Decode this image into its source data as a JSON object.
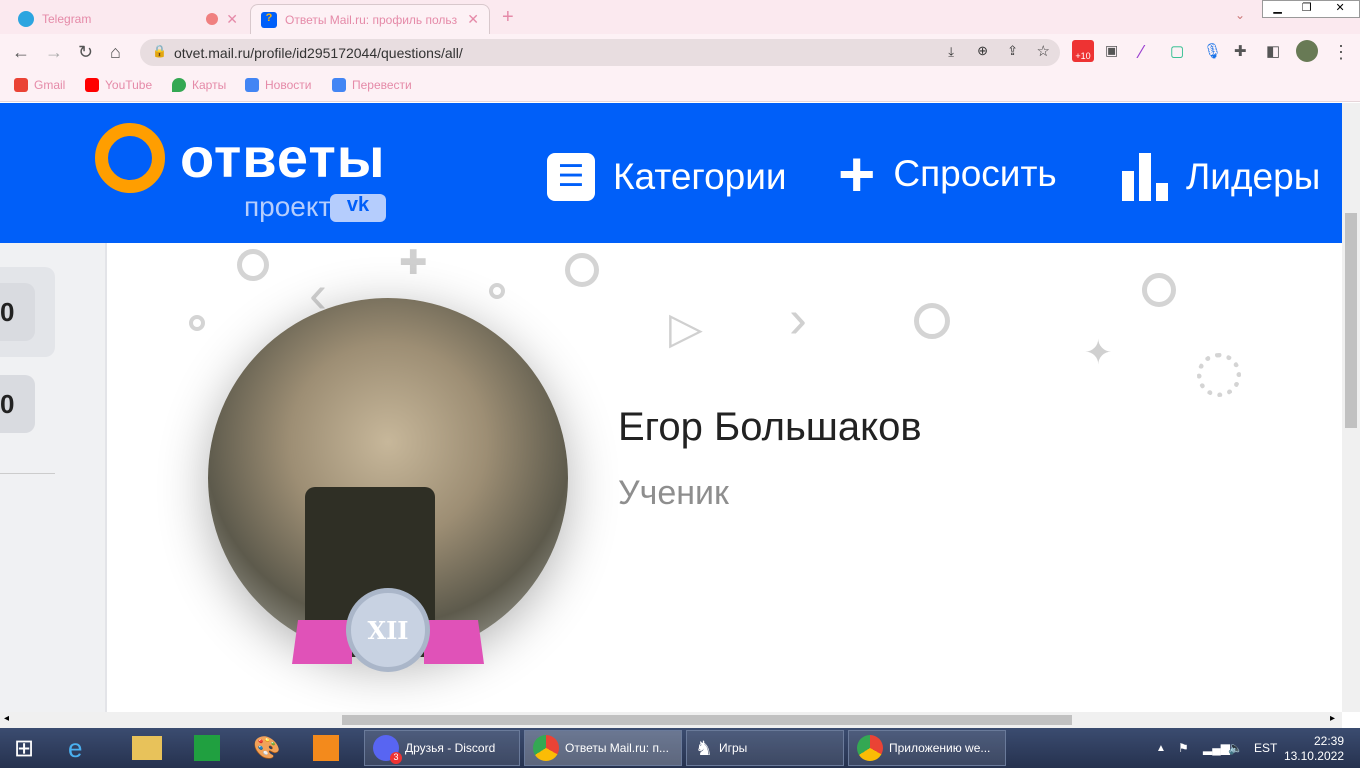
{
  "browser": {
    "tabs": [
      {
        "label": "Telegram",
        "active": false
      },
      {
        "label": "Ответы Mail.ru: профиль польз",
        "active": true
      }
    ],
    "url": "otvet.mail.ru/profile/id295172044/questions/all/",
    "extension_badge": "+10",
    "bookmarks": [
      "Gmail",
      "YouTube",
      "Карты",
      "Новости",
      "Перевести"
    ]
  },
  "header": {
    "logo_text": "ответы",
    "logo_sub": "проект",
    "logo_vk": "vk",
    "nav": [
      "Категории",
      "Спросить",
      "Лидеры"
    ],
    "color": "#005ff9"
  },
  "sidebar": {
    "counts": [
      "0",
      "0"
    ]
  },
  "profile": {
    "name": "Егор Большаков",
    "rank": "Ученик",
    "badge": "XII"
  },
  "taskbar": {
    "items": [
      "Друзья - Discord",
      "Ответы Mail.ru: п...",
      "Игры",
      "Приложению we..."
    ],
    "discord_badge": "3",
    "lang": "EST",
    "time": "22:39",
    "date": "13.10.2022"
  }
}
